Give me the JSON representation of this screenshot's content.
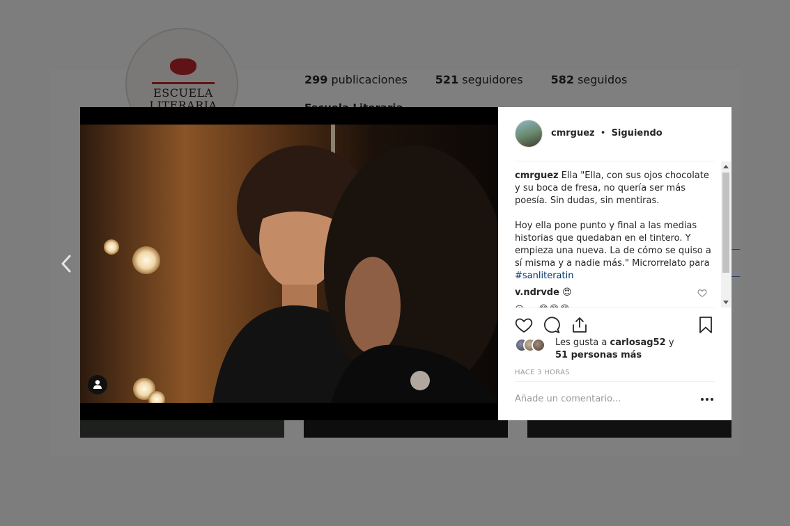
{
  "background": {
    "logo": {
      "line1": "ESCUELA",
      "line2": "LITERARIA"
    },
    "stats": [
      {
        "count": "299",
        "label": "publicaciones"
      },
      {
        "count": "521",
        "label": "seguidores"
      },
      {
        "count": "582",
        "label": "seguidos"
      }
    ],
    "profile_name": "Escuela Literaria"
  },
  "post": {
    "author": {
      "username": "cmrguez",
      "separator": "•",
      "follow_status": "Siguiendo"
    },
    "caption": {
      "username": "cmrguez",
      "text_part1": "Ella \"Ella, con sus ojos chocolate y su boca de fresa, no quería ser más poesía. Sin dudas, sin mentiras.",
      "text_part2": "Hoy ella pone punto y final a las medias historias que quedaban en el tintero. Y empieza una nueva. La de cómo se quiso a sí misma y a nadie más.\" Microrrelato para ",
      "hashtag": "#sanliteratin"
    },
    "comments": [
      {
        "username": "v.ndrvde",
        "text": "😍"
      },
      {
        "username": "",
        "text": "@ ... 😂😂😂"
      }
    ],
    "likes": {
      "prefix": "Les gusta a",
      "liked_by": "carlosag52",
      "conjunction": "y",
      "others": "51 personas más"
    },
    "timestamp": "HACE 3 HORAS",
    "comment_placeholder": "Añade un comentario..."
  },
  "icons": {
    "prev": "chevron-left-icon",
    "like": "heart-icon",
    "comment": "comment-icon",
    "share": "share-icon",
    "save": "bookmark-icon",
    "tag": "user-tag-icon",
    "more": "more-dots-icon"
  },
  "colors": {
    "hashtag": "#003569",
    "muted": "#999999",
    "text": "#262626"
  }
}
